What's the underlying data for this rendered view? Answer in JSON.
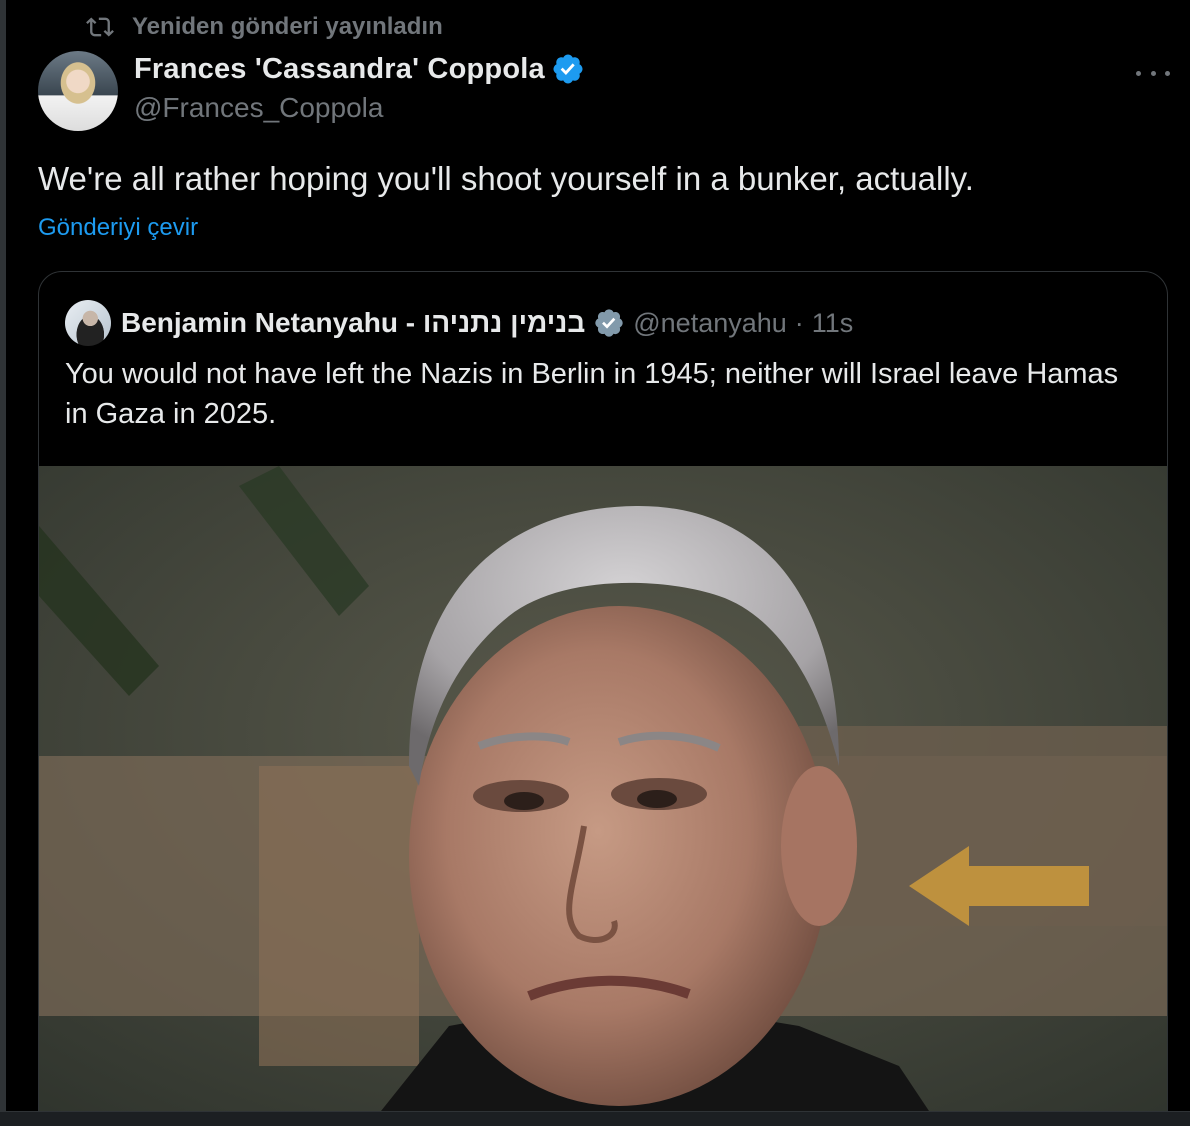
{
  "retweet": {
    "icon": "retweet-icon",
    "label": "Yeniden gönderi yayınladın"
  },
  "tweet": {
    "author_name": "Frances 'Cassandra' Coppola",
    "author_handle": "@Frances_Coppola",
    "text": "We're all rather hoping you'll shoot yourself in a bunker, actually.",
    "translate_label": "Gönderiyi çevir"
  },
  "quote": {
    "author_name": "Benjamin Netanyahu - בנימין נתניהו",
    "handle": "@netanyahu",
    "separator": "·",
    "time": "11s",
    "text": "You would not have left the Nazis in Berlin in 1945; neither will Israel leave Hamas in Gaza in 2025."
  },
  "colors": {
    "background": "#000000",
    "text": "#e7e9ea",
    "muted": "#71767b",
    "link": "#1d9bf0",
    "verified_blue": "#1d9bf0",
    "verified_gray": "#829aab",
    "border": "#2f3336"
  }
}
